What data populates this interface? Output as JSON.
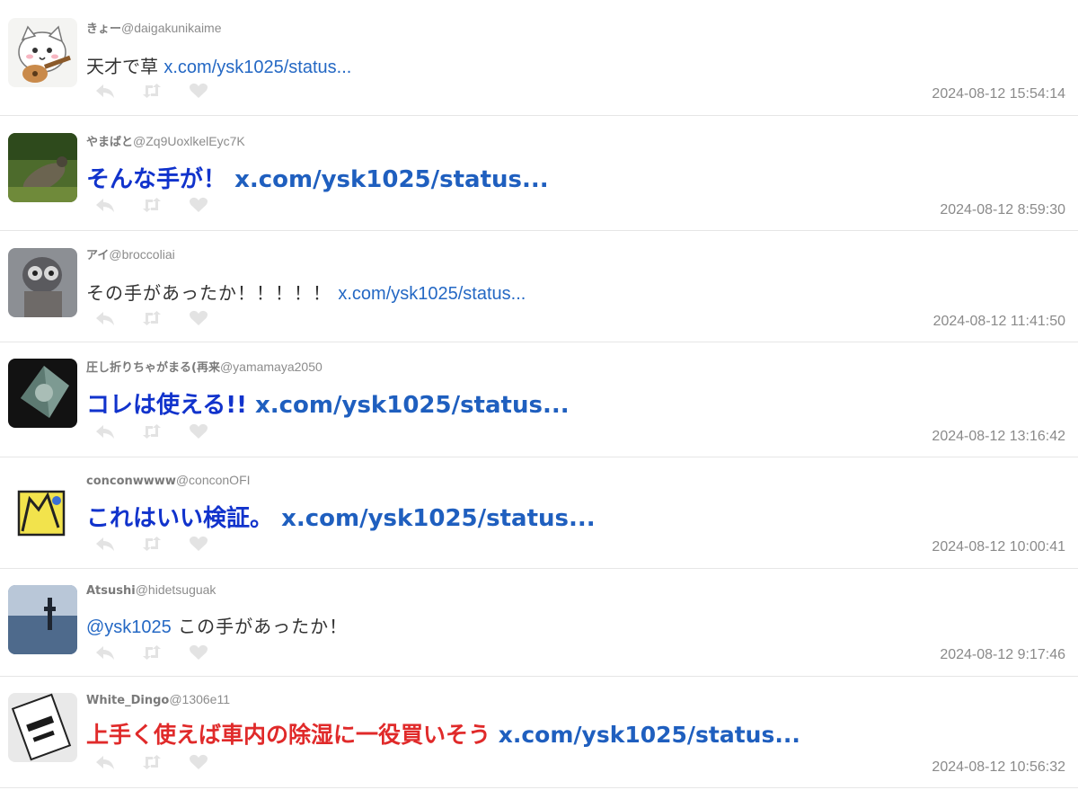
{
  "tweets": [
    {
      "name": "きょー",
      "handle": "@daigakunikaime",
      "text": "天才で草 ",
      "link": "x.com/ysk1025/status...",
      "time": "2024-08-12 15:54:14"
    },
    {
      "name": "やまばと",
      "handle": "@Zq9UoxlkelEyc7K",
      "text": "そんな手が！ ",
      "link": "x.com/ysk1025/status...",
      "time": "2024-08-12 8:59:30"
    },
    {
      "name": "アイ",
      "handle": "@broccoliai",
      "text": "その手があったか！！！！！ ",
      "link": "x.com/ysk1025/status...",
      "time": "2024-08-12 11:41:50"
    },
    {
      "name": "圧し折りちゃがまる(再来",
      "handle": "@yamamaya2050",
      "text": "コレは使える!! ",
      "link": "x.com/ysk1025/status...",
      "time": "2024-08-12 13:16:42"
    },
    {
      "name": "conconwwww",
      "handle": "@conconOFI",
      "text": "これはいい検証。 ",
      "link": "x.com/ysk1025/status...",
      "time": "2024-08-12 10:00:41"
    },
    {
      "name": "Atsushi",
      "handle": "@hidetsuguak",
      "mention": "@ysk1025",
      "text": " この手があったか！",
      "time": "2024-08-12 9:17:46"
    },
    {
      "name": "White_Dingo",
      "handle": "@1306e11",
      "text": "上手く使えば車内の除湿に一役買いそう ",
      "link": "x.com/ysk1025/status...",
      "time": "2024-08-12 10:56:32"
    }
  ],
  "actions": {
    "reply_icon": "reply-icon",
    "retweet_icon": "retweet-icon",
    "like_icon": "heart-icon",
    "icon_color": "#e3e3e3"
  },
  "colors": {
    "link": "#2468c4",
    "emphasis_blue": "#1133cc",
    "emphasis_red": "#e02a2a",
    "meta": "#8a8a8a"
  }
}
